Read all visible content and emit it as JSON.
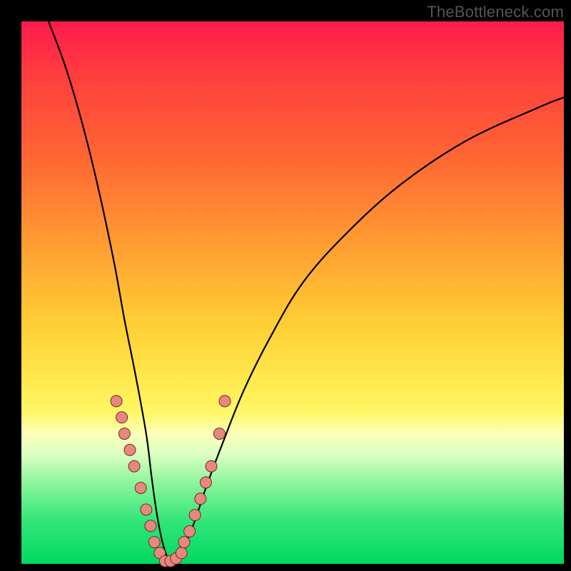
{
  "watermark": "TheBottleneck.com",
  "colors": {
    "background": "#000000",
    "curve_stroke": "#000000",
    "marker_fill": "#e8877f",
    "marker_stroke": "#6b2b26"
  },
  "chart_data": {
    "type": "line",
    "title": "",
    "xlabel": "",
    "ylabel": "",
    "xlim": [
      0,
      100
    ],
    "ylim": [
      0,
      100
    ],
    "note": "Two asymmetric curves descending into a V-shaped trough near x≈26; y visually maps to a bottleneck heatmap (red=high, green=low). Values are estimated from pixel positions on the gradient.",
    "series": [
      {
        "name": "left-curve",
        "x": [
          5,
          8,
          11,
          14,
          17,
          19,
          21,
          23,
          24,
          25,
          26,
          27,
          28
        ],
        "y": [
          100,
          92,
          82,
          70,
          56,
          45,
          35,
          24,
          16,
          9,
          4,
          1,
          0
        ]
      },
      {
        "name": "right-curve",
        "x": [
          28,
          29,
          30,
          32,
          34,
          37,
          41,
          46,
          52,
          60,
          70,
          82,
          95,
          100
        ],
        "y": [
          0,
          1,
          3,
          8,
          14,
          22,
          32,
          42,
          52,
          61,
          70,
          78,
          84,
          86
        ]
      }
    ],
    "markers": {
      "name": "sample-points",
      "x": [
        17.5,
        18.5,
        19.0,
        20.0,
        20.8,
        22.0,
        23.0,
        23.8,
        24.5,
        25.5,
        26.5,
        27.5,
        28.5,
        29.5,
        30.0,
        31.0,
        32.0,
        33.0,
        34.0,
        35.0,
        36.5,
        37.5
      ],
      "y": [
        30,
        27,
        24,
        21,
        18,
        14,
        10,
        7,
        4,
        2,
        0.5,
        0.5,
        1,
        2,
        4,
        6,
        9,
        12,
        15,
        18,
        24,
        30
      ]
    }
  }
}
